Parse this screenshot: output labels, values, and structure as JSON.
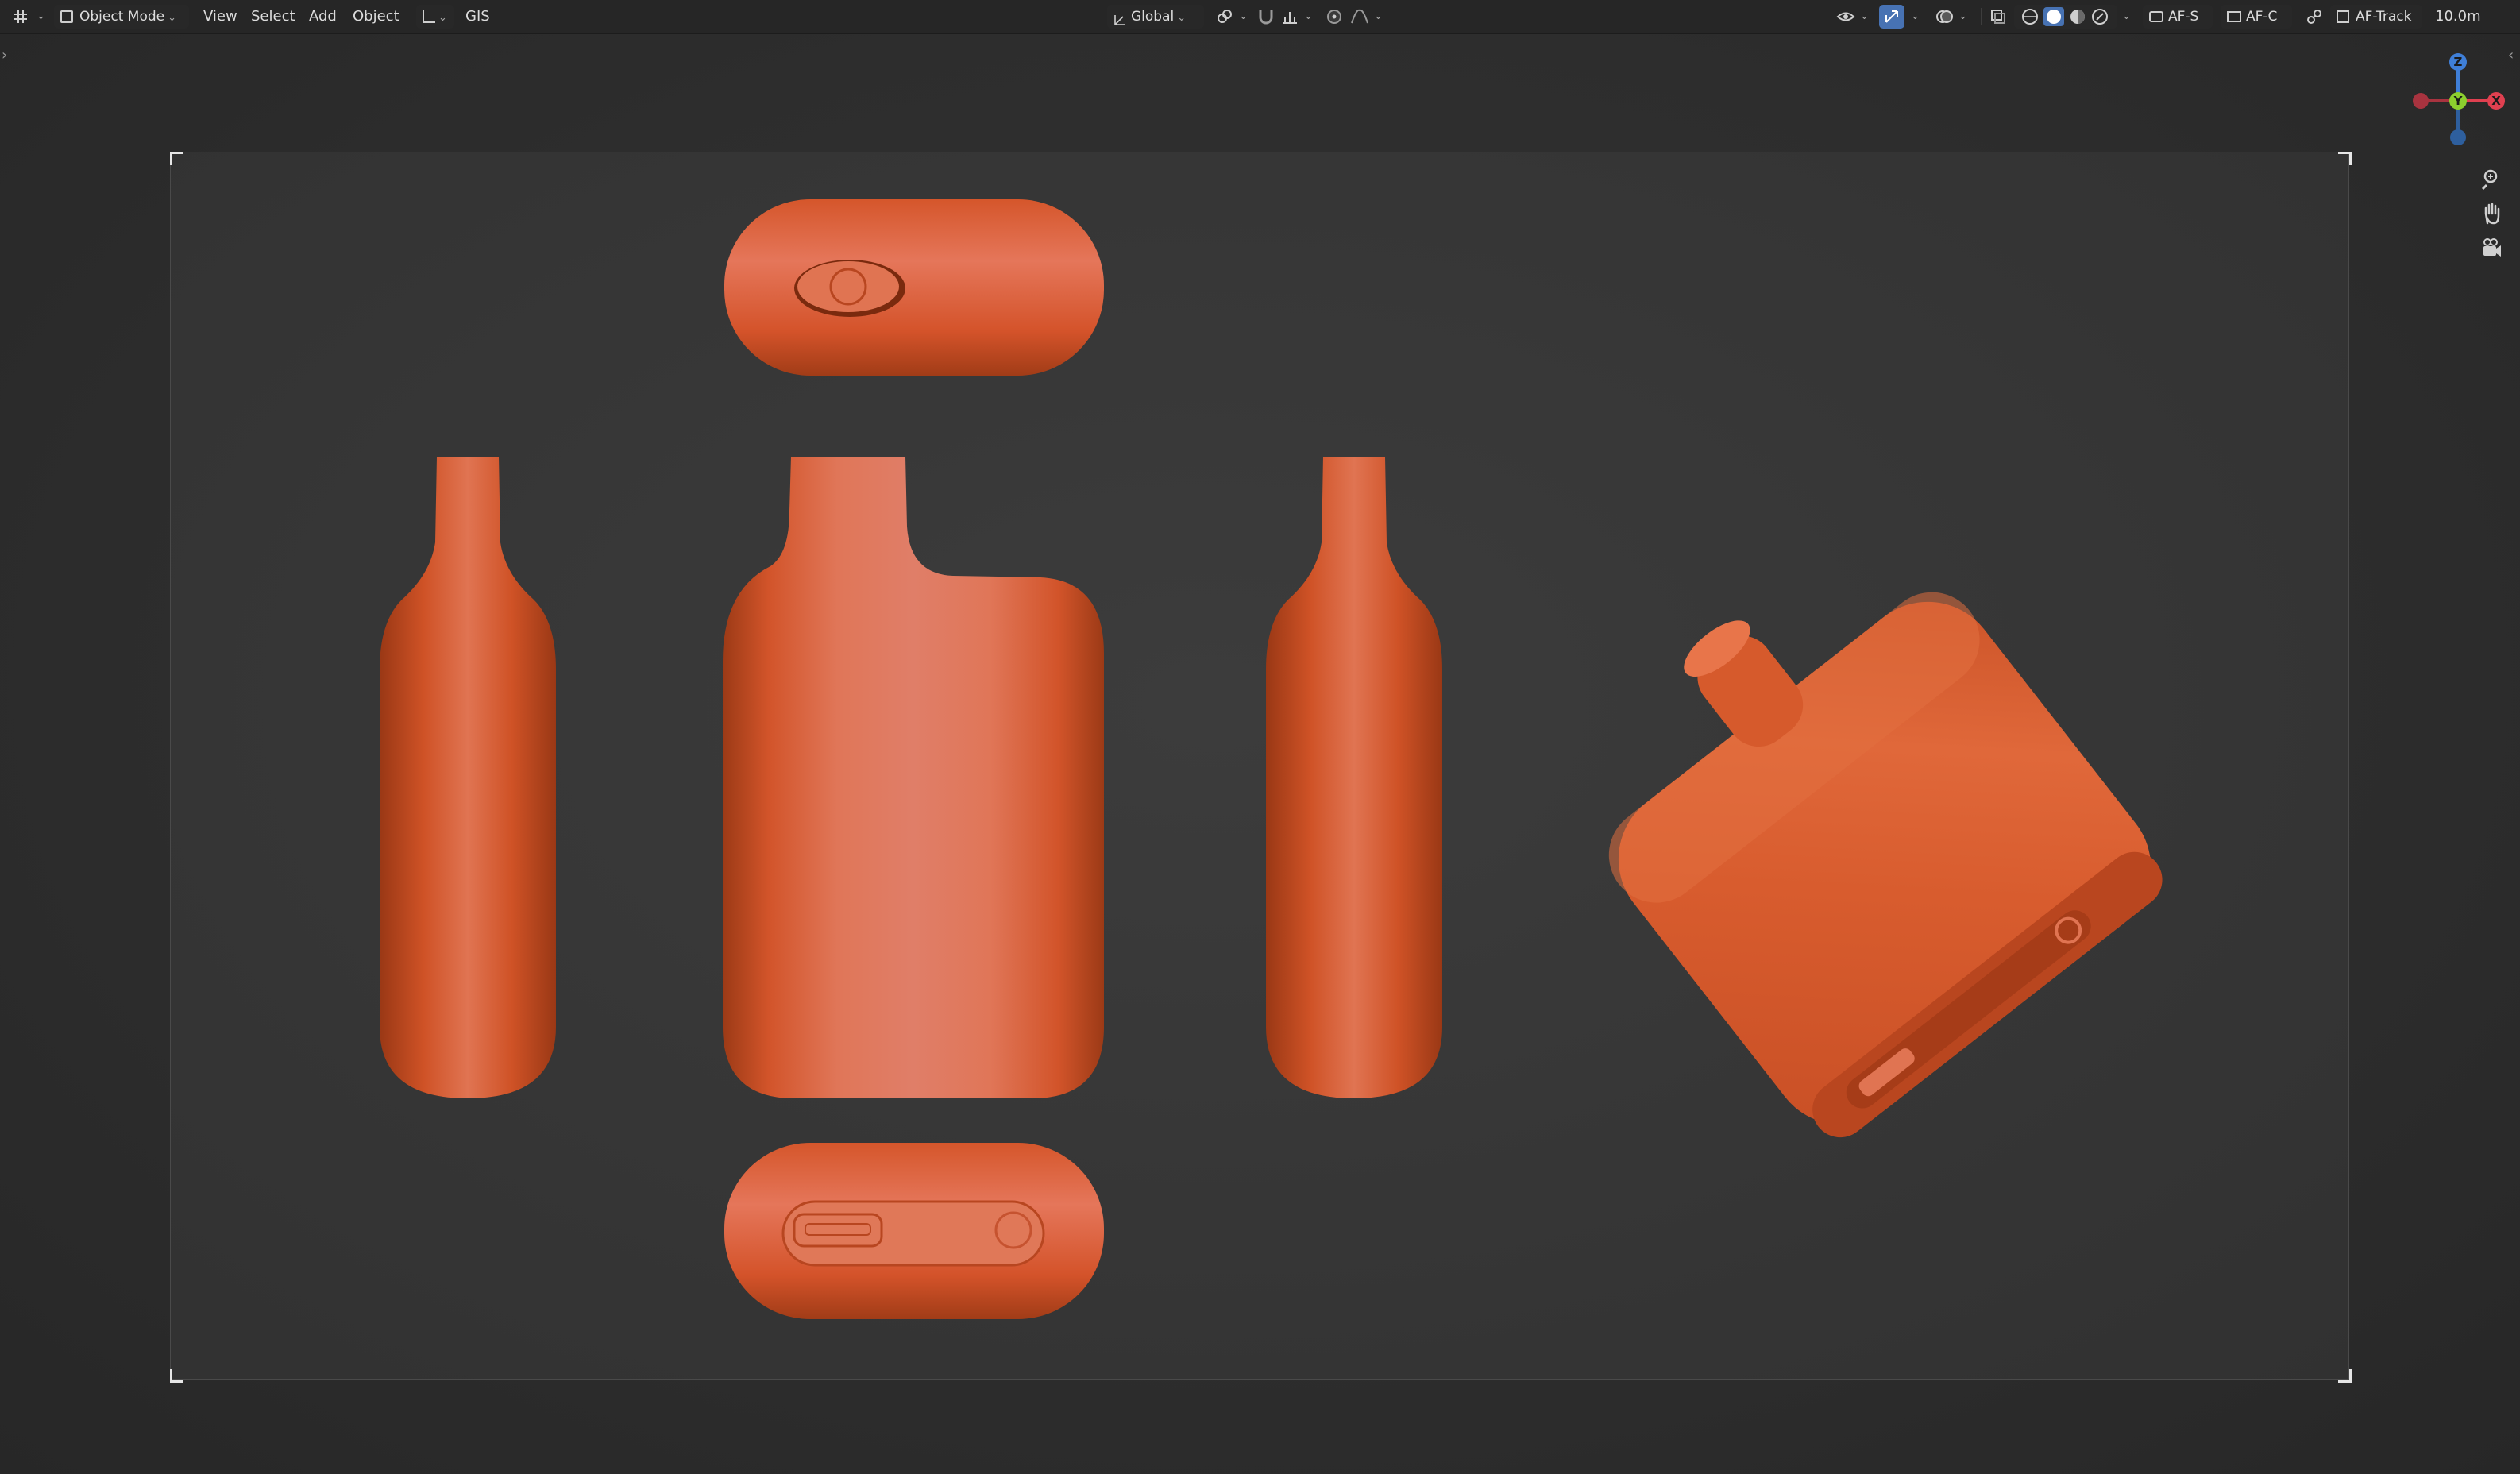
{
  "header": {
    "mode_label": "Object Mode",
    "menus": [
      "View",
      "Select",
      "Add",
      "Object"
    ],
    "gis_label": "GIS",
    "transform_orientation": "Global",
    "af_s_label": "AF-S",
    "af_c_label": "AF-C",
    "af_track_label": "AF-Track",
    "clip_distance": "10.0m"
  },
  "gizmo": {
    "z_label": "Z",
    "y_label": "Y",
    "x_label": "X"
  },
  "colors": {
    "model": "#d95a2b",
    "model_highlight": "#e8866a",
    "axis_x": "#e04050",
    "axis_y": "#8ccf2e",
    "axis_z": "#3f7fd8",
    "header_bg": "#262626",
    "viewport_bg": "#2d2d2d"
  },
  "icons": {
    "editor_type": "grid-editor-icon",
    "object_mode": "cube-icon",
    "transform_pivot": "pivot-icon",
    "snapping": "magnet-icon",
    "proportional": "proportional-edit-icon",
    "visibility": "eye-icon",
    "gizmos": "gizmo-toggle-icon",
    "overlays": "overlay-icon",
    "xray": "xray-icon",
    "shading": [
      "wireframe-shading-icon",
      "solid-shading-icon",
      "material-shading-icon",
      "rendered-shading-icon"
    ],
    "zoom": "zoom-icon",
    "pan": "hand-icon",
    "camera": "camera-icon"
  }
}
